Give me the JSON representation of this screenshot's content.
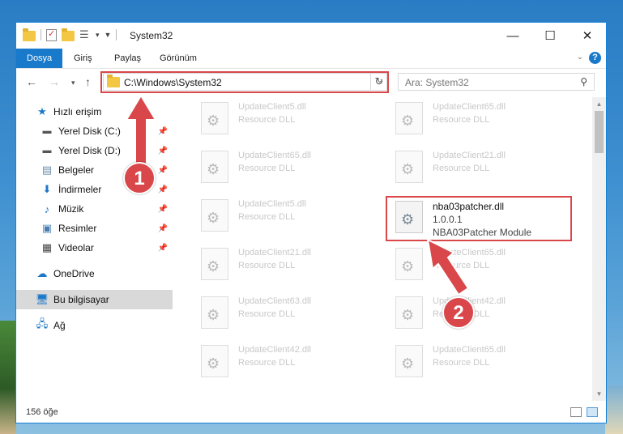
{
  "window": {
    "title": "System32",
    "controls": {
      "minimize": "—",
      "maximize": "☐",
      "close": "✕"
    }
  },
  "ribbon": {
    "tabs": [
      "Dosya",
      "Giriş",
      "Paylaş",
      "Görünüm"
    ],
    "help_label": "?"
  },
  "nav": {
    "address": "C:\\Windows\\System32",
    "search_placeholder": "Ara: System32",
    "refresh_label": "↻"
  },
  "sidebar": {
    "items": [
      {
        "label": "Hızlı erişim",
        "icon": "star-icon"
      },
      {
        "label": "Yerel Disk (C:)",
        "icon": "drive-icon"
      },
      {
        "label": "Yerel Disk (D:)",
        "icon": "drive-icon"
      },
      {
        "label": "Belgeler",
        "icon": "documents-icon"
      },
      {
        "label": "İndirmeler",
        "icon": "download-icon"
      },
      {
        "label": "Müzik",
        "icon": "music-icon"
      },
      {
        "label": "Resimler",
        "icon": "pictures-icon"
      },
      {
        "label": "Videolar",
        "icon": "video-icon"
      },
      {
        "label": "OneDrive",
        "icon": "cloud-icon"
      },
      {
        "label": "Bu bilgisayar",
        "icon": "computer-icon"
      },
      {
        "label": "Ağ",
        "icon": "network-icon"
      }
    ]
  },
  "files": [
    {
      "name": "UpdateClient5.dll",
      "desc": "Resource DLL"
    },
    {
      "name": "UpdateClient65.dll",
      "desc": "Resource DLL"
    },
    {
      "name": "UpdateClient65.dll",
      "desc": "Resource DLL"
    },
    {
      "name": "UpdateClient21.dll",
      "desc": "Resource DLL"
    },
    {
      "name": "UpdateClient5.dll",
      "desc": "Resource DLL"
    },
    {
      "name": "nba03patcher.dll",
      "version": "1.0.0.1",
      "desc": "NBA03Patcher Module"
    },
    {
      "name": "UpdateClient21.dll",
      "desc": "Resource DLL"
    },
    {
      "name": "UpdateClient65.dll",
      "desc": "Resource DLL"
    },
    {
      "name": "UpdateClient63.dll",
      "desc": "Resource DLL"
    },
    {
      "name": "UpdateClient42.dll",
      "desc": "Resource DLL"
    },
    {
      "name": "UpdateClient42.dll",
      "desc": "Resource DLL"
    },
    {
      "name": "UpdateClient65.dll",
      "desc": "Resource DLL"
    }
  ],
  "status": {
    "count_text": "156 öğe"
  },
  "annotations": {
    "step1": "1",
    "step2": "2",
    "color": "#d9474a"
  }
}
